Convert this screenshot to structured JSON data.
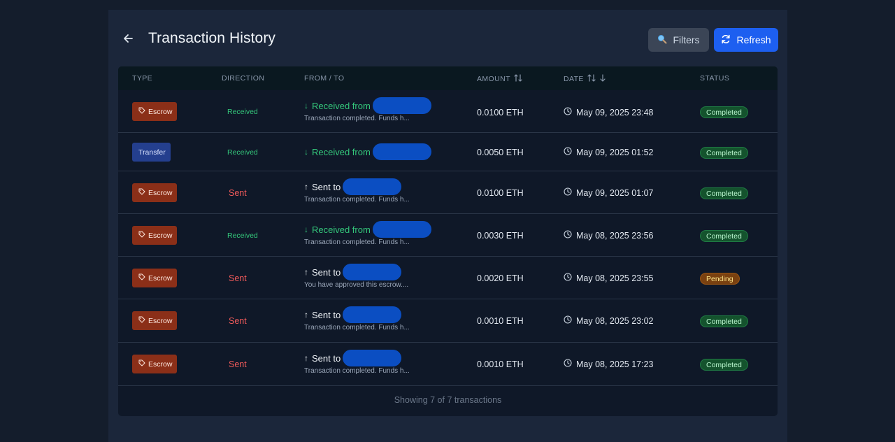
{
  "header": {
    "title": "Transaction History",
    "filters_label": "Filters",
    "refresh_label": "Refresh"
  },
  "columns": {
    "type": "TYPE",
    "direction": "DIRECTION",
    "from_to": "FROM / TO",
    "amount": "AMOUNT",
    "date": "DATE",
    "status": "STATUS"
  },
  "rows": [
    {
      "type": "Escrow",
      "direction": "Received",
      "party_prefix": "Received from",
      "note": "Transaction completed. Funds h...",
      "amount": "0.0100 ETH",
      "date": "May 09, 2025 23:48",
      "status": "Completed"
    },
    {
      "type": "Transfer",
      "direction": "Received",
      "party_prefix": "Received from",
      "note": "",
      "amount": "0.0050 ETH",
      "date": "May 09, 2025 01:52",
      "status": "Completed"
    },
    {
      "type": "Escrow",
      "direction": "Sent",
      "party_prefix": "Sent to",
      "note": "Transaction completed. Funds h...",
      "amount": "0.0100 ETH",
      "date": "May 09, 2025 01:07",
      "status": "Completed"
    },
    {
      "type": "Escrow",
      "direction": "Received",
      "party_prefix": "Received from",
      "note": "Transaction completed. Funds h...",
      "amount": "0.0030 ETH",
      "date": "May 08, 2025 23:56",
      "status": "Completed"
    },
    {
      "type": "Escrow",
      "direction": "Sent",
      "party_prefix": "Sent to",
      "note": "You have approved this escrow....",
      "amount": "0.0020 ETH",
      "date": "May 08, 2025 23:55",
      "status": "Pending"
    },
    {
      "type": "Escrow",
      "direction": "Sent",
      "party_prefix": "Sent to",
      "note": "Transaction completed. Funds h...",
      "amount": "0.0010 ETH",
      "date": "May 08, 2025 23:02",
      "status": "Completed"
    },
    {
      "type": "Escrow",
      "direction": "Sent",
      "party_prefix": "Sent to",
      "note": "Transaction completed. Funds h...",
      "amount": "0.0010 ETH",
      "date": "May 08, 2025 17:23",
      "status": "Completed"
    }
  ],
  "footer": {
    "summary": "Showing 7 of 7 transactions"
  },
  "icons": {
    "back": "arrow-left-icon",
    "filters": "search-icon",
    "refresh": "refresh-icon",
    "sort": "sort-icon",
    "sort_desc": "arrow-down-icon",
    "tag": "tag-icon",
    "clock": "clock-icon"
  },
  "colors": {
    "accent": "#1d5ff0",
    "received": "#34c77b",
    "sent": "#ef5a5a",
    "escrow": "#8b2f18",
    "transfer": "#243f8e",
    "completed": "#14532d",
    "pending": "#7a4110"
  }
}
